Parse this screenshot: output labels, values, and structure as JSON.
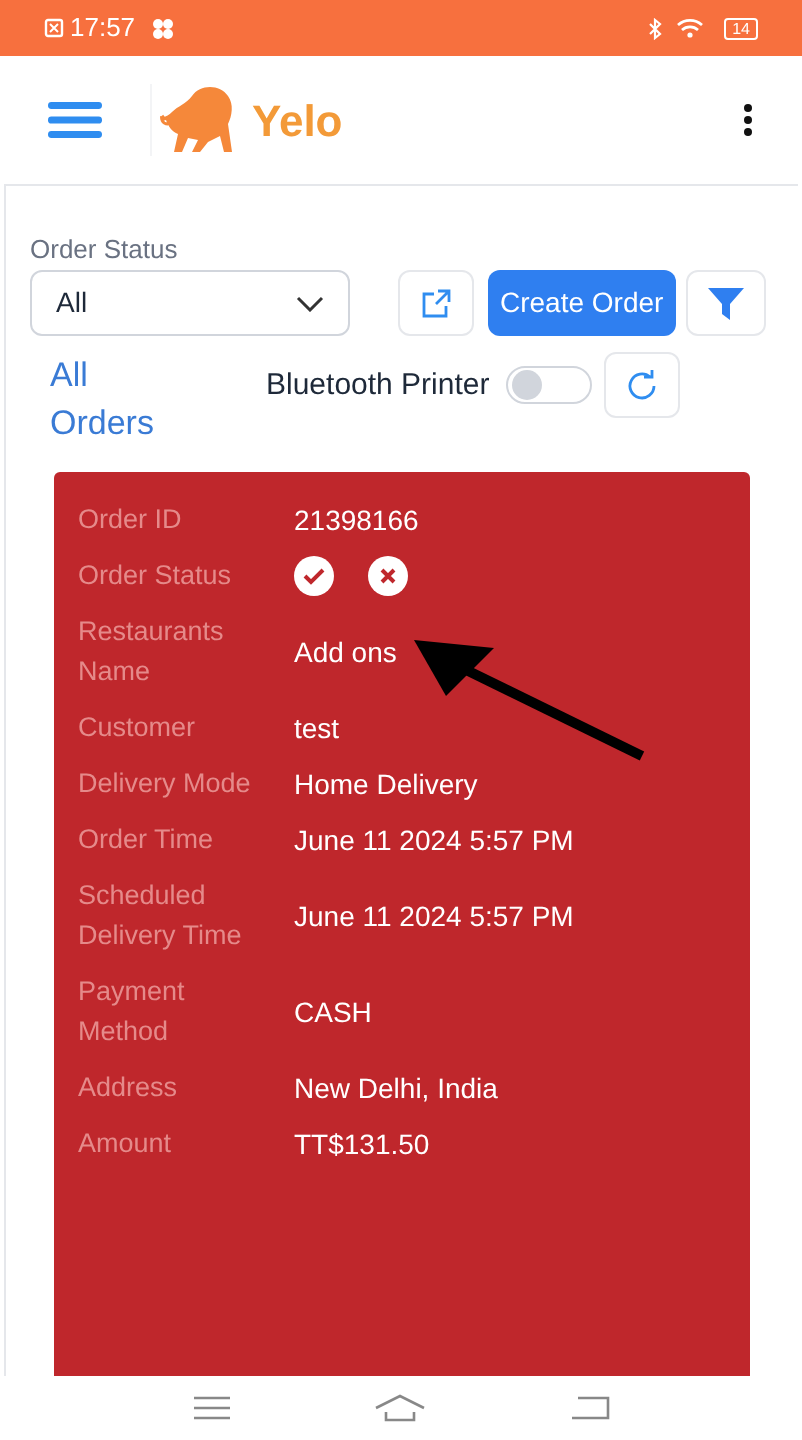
{
  "status_bar": {
    "time": "17:57",
    "battery": "14"
  },
  "app_bar": {
    "brand": "Yelo"
  },
  "filters": {
    "order_status_label": "Order Status",
    "order_status_value": "All",
    "create_button": "Create Order"
  },
  "orders_link": "All Orders",
  "printer": {
    "label": "Bluetooth Printer",
    "on": false
  },
  "order_card": {
    "rows": [
      {
        "kind": "text",
        "label": "Order ID",
        "value": "21398166"
      },
      {
        "kind": "status_actions",
        "label": "Order Status"
      },
      {
        "kind": "text",
        "label": "Restaurants Name",
        "value": "Add ons"
      },
      {
        "kind": "text",
        "label": "Customer",
        "value": "test"
      },
      {
        "kind": "text",
        "label": "Delivery Mode",
        "value": "Home Delivery"
      },
      {
        "kind": "text",
        "label": "Order Time",
        "value": "June 11 2024 5:57 PM"
      },
      {
        "kind": "text",
        "label": "Scheduled Delivery Time",
        "value": "June 11 2024 5:57 PM"
      },
      {
        "kind": "text",
        "label": "Payment Method",
        "value": "CASH"
      },
      {
        "kind": "text",
        "label": "Address",
        "value": "New Delhi, India"
      },
      {
        "kind": "text",
        "label": "Amount",
        "value": "TT$131.50"
      }
    ]
  }
}
